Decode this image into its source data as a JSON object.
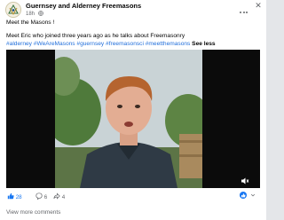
{
  "post": {
    "page_name": "Guernsey and Alderney Freemasons",
    "time": "18h",
    "line1": "Meet the Masons !",
    "line2": "Meet Eric who joined three years ago as he talks about Freemasonry",
    "hashtags": "#alderney #WeAreMasons #guernsey #freemasonsci #meetthemasons",
    "see_less": "See less"
  },
  "stats": {
    "likes": "28",
    "comments": "6",
    "shares": "4"
  },
  "comments_link": "View more comments",
  "colors": {
    "accent": "#1877f2",
    "hashtag": "#216fdb",
    "muted": "#65676b"
  },
  "icons": [
    "globe-icon",
    "more-options-icon",
    "close-icon",
    "mute-icon",
    "like-icon",
    "comment-icon",
    "share-icon",
    "reaction-icon"
  ]
}
